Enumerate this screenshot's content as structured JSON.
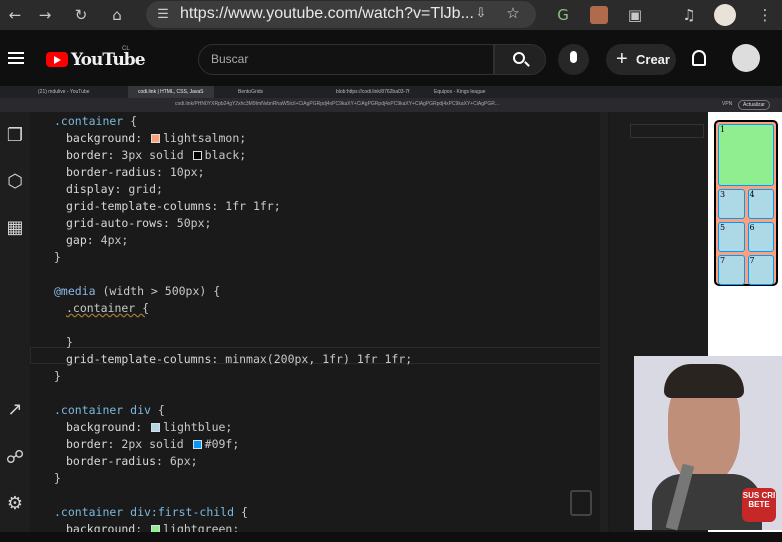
{
  "browser": {
    "url": "https://www.youtube.com/watch?v=TlJb..."
  },
  "youtube": {
    "logo_text": "YouTube",
    "logo_sup": "CL",
    "search_placeholder": "Buscar",
    "create_label": "Crear"
  },
  "video": {
    "tabs": [
      "(21) mdulive - YouTube",
      "codi.link | HTML, CSS, JavaS",
      "BentoGrids",
      "blob:https://codi.link/8762ba03-7f",
      "Equipos - Kings league"
    ],
    "inner_url": "codi.link/PHN0YXRpb24gY2xhc3M9ImNvbnRhaW5lciI+CiAgPGRpdj4xPC9kaXY+CiAgPGRpdj4xPC9kaXY+CiAgPGRpdj4xPC9kaXY+CiAgPGR...",
    "update_label": "Actualizar",
    "vpn_label": "VPN",
    "code_lines": {
      "l1_sel": ".container",
      "l1_brace": " {",
      "l2_prop": "background",
      "l2_val": "lightsalmon;",
      "l3_prop": "border",
      "l3_val_a": "3px solid ",
      "l3_val_b": "black;",
      "l4_prop": "border-radius",
      "l4_val": "10px;",
      "l5_prop": "display",
      "l5_val": "grid;",
      "l6_prop": "grid-template-columns",
      "l6_val": "1fr 1fr;",
      "l7_prop": "grid-auto-rows",
      "l7_val": "50px;",
      "l8_prop": "gap",
      "l8_val": "4px;",
      "l9": "}",
      "l11_kw": "@media",
      "l11_rest": " (width > 500px) {",
      "l12": ".container {",
      "l14": "}",
      "l15_prop": "grid-template-columns",
      "l15_val": "minmax(200px, 1fr) 1fr 1fr;",
      "l16": "}",
      "l18_sel": ".container div",
      "l18_brace": " {",
      "l19_prop": "background",
      "l19_val": "lightblue;",
      "l20_prop": "border",
      "l20_val_a": "2px solid ",
      "l20_val_b": "#09f;",
      "l21_prop": "border-radius",
      "l21_val": "6px;",
      "l22": "}",
      "l24_sel": ".container div:first-child",
      "l24_brace": " {",
      "l25_prop": "background",
      "l25_val": "lightgreen;"
    },
    "preview_cells": [
      "1",
      "3",
      "4",
      "5",
      "6",
      "7",
      "7"
    ],
    "subscribe_label": "SUS CRI BETE"
  },
  "colors": {
    "lightsalmon": "#ffa07a",
    "black": "#000000",
    "lightblue": "#add8e6",
    "blue09f": "#0099ff",
    "lightgreen": "#90ee90"
  }
}
